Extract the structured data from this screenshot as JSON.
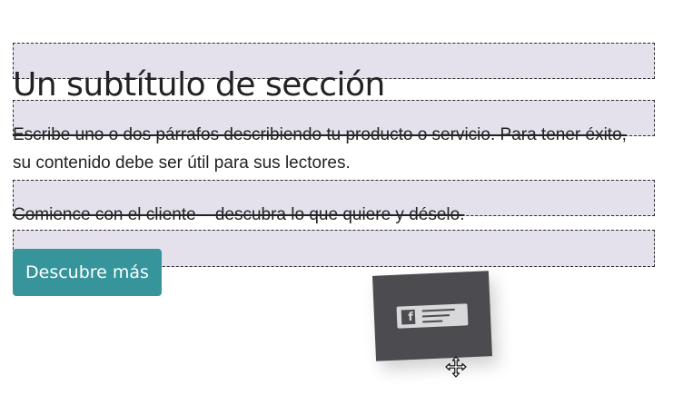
{
  "section": {
    "heading": "Un subtítulo de sección",
    "paragraph_1": "Escribe uno o dos párrafos describiendo tu producto o servicio. Para tener éxito, su contenido debe ser útil para sus lectores.",
    "paragraph_2": "Comience con el cliente – descubra lo que quiere y déselo.",
    "cta_label": "Descubre más"
  },
  "drag": {
    "snippet_icon": "facebook-icon",
    "cursor_icon": "move-cursor-icon"
  },
  "colors": {
    "dropzone_fill": "#e4e1ec",
    "dropzone_border": "#2b2b2b",
    "cta_background": "#35959b",
    "snippet_background": "#4c4b50"
  }
}
